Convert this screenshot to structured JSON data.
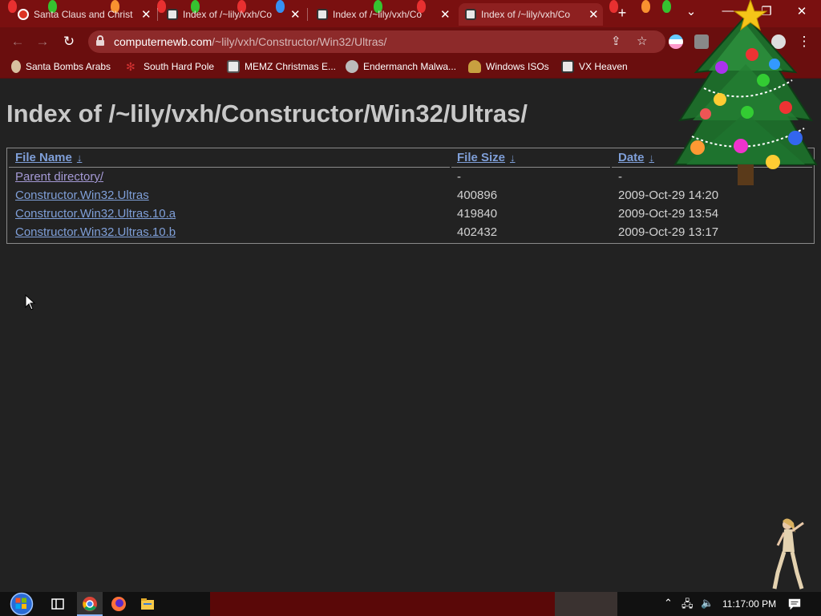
{
  "browser": {
    "tabs": [
      {
        "title": "Santa Claus and Christ",
        "active": false
      },
      {
        "title": "Index of /~lily/vxh/Co",
        "active": false
      },
      {
        "title": "Index of /~lily/vxh/Co",
        "active": false
      },
      {
        "title": "Index of /~lily/vxh/Co",
        "active": true
      }
    ],
    "new_tab_symbol": "+",
    "tab_close_symbol": "✕",
    "address": {
      "host": "computernewb.com",
      "path": "/~lily/vxh/Constructor/Win32/Ultras/"
    },
    "bookmarks": [
      {
        "label": "Santa Bombs Arabs",
        "icon": "santa-icon",
        "color": "#d8c0a0"
      },
      {
        "label": "South Hard Pole",
        "icon": "snowflake-icon",
        "color": "#d03030"
      },
      {
        "label": "MEMZ Christmas E...",
        "icon": "page-icon",
        "color": "#e8e8e8"
      },
      {
        "label": "Endermanch Malwa...",
        "icon": "raccoon-icon",
        "color": "#bbbbbb"
      },
      {
        "label": "Windows ISOs",
        "icon": "figure-icon",
        "color": "#c8a040"
      },
      {
        "label": "VX Heaven",
        "icon": "vx-icon",
        "color": "#e8e8e8"
      }
    ],
    "accent": "#7a1010"
  },
  "page": {
    "heading": "Index of /~lily/vxh/Constructor/Win32/Ultras/",
    "columns": {
      "name": "File Name",
      "size": "File Size",
      "date": "Date",
      "sort_indicator": "↓"
    },
    "rows": [
      {
        "name": "Parent directory/",
        "size": "-",
        "date": "-",
        "visited": true
      },
      {
        "name": "Constructor.Win32.Ultras",
        "size": "400896",
        "date": "2009-Oct-29 14:20",
        "visited": false
      },
      {
        "name": "Constructor.Win32.Ultras.10.a",
        "size": "419840",
        "date": "2009-Oct-29 13:54",
        "visited": false
      },
      {
        "name": "Constructor.Win32.Ultras.10.b",
        "size": "402432",
        "date": "2009-Oct-29 13:17",
        "visited": false
      }
    ],
    "link_color": "#7f9fd8",
    "visited_color": "#a59ad6"
  },
  "taskbar": {
    "clock": "11:17:00 PM",
    "icons": [
      "start-orb-icon",
      "task-view-icon",
      "chrome-icon",
      "firefox-icon",
      "file-explorer-icon"
    ]
  }
}
